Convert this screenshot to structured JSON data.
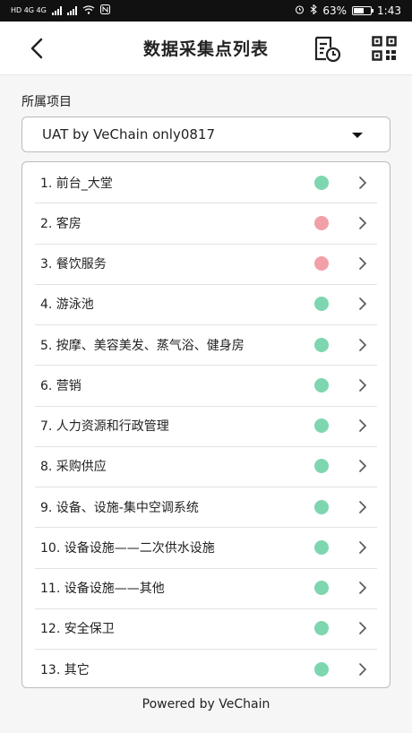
{
  "status_bar": {
    "left_text": "HD 4G 4G",
    "battery_percent": "63%",
    "battery_level": 0.63,
    "time": "1:43"
  },
  "header": {
    "title": "数据采集点列表",
    "back_icon": "chevron-left-icon",
    "record_icon": "document-clock-icon",
    "qr_icon": "qr-code-icon"
  },
  "project": {
    "label": "所属项目",
    "selected": "UAT by VeChain only0817"
  },
  "colors": {
    "green": "#7ed6b0",
    "pink": "#f2a0a8"
  },
  "items": [
    {
      "label": "1. 前台_大堂",
      "status": "green"
    },
    {
      "label": "2. 客房",
      "status": "pink"
    },
    {
      "label": "3. 餐饮服务",
      "status": "pink"
    },
    {
      "label": "4. 游泳池",
      "status": "green"
    },
    {
      "label": "5. 按摩、美容美发、蒸气浴、健身房",
      "status": "green"
    },
    {
      "label": "6. 营销",
      "status": "green"
    },
    {
      "label": "7. 人力资源和行政管理",
      "status": "green"
    },
    {
      "label": "8. 采购供应",
      "status": "green"
    },
    {
      "label": "9. 设备、设施-集中空调系统",
      "status": "green"
    },
    {
      "label": "10. 设备设施——二次供水设施",
      "status": "green"
    },
    {
      "label": "11. 设备设施——其他",
      "status": "green"
    },
    {
      "label": "12. 安全保卫",
      "status": "green"
    },
    {
      "label": "13. 其它",
      "status": "green"
    }
  ],
  "footer": {
    "text": "Powered by VeChain"
  }
}
